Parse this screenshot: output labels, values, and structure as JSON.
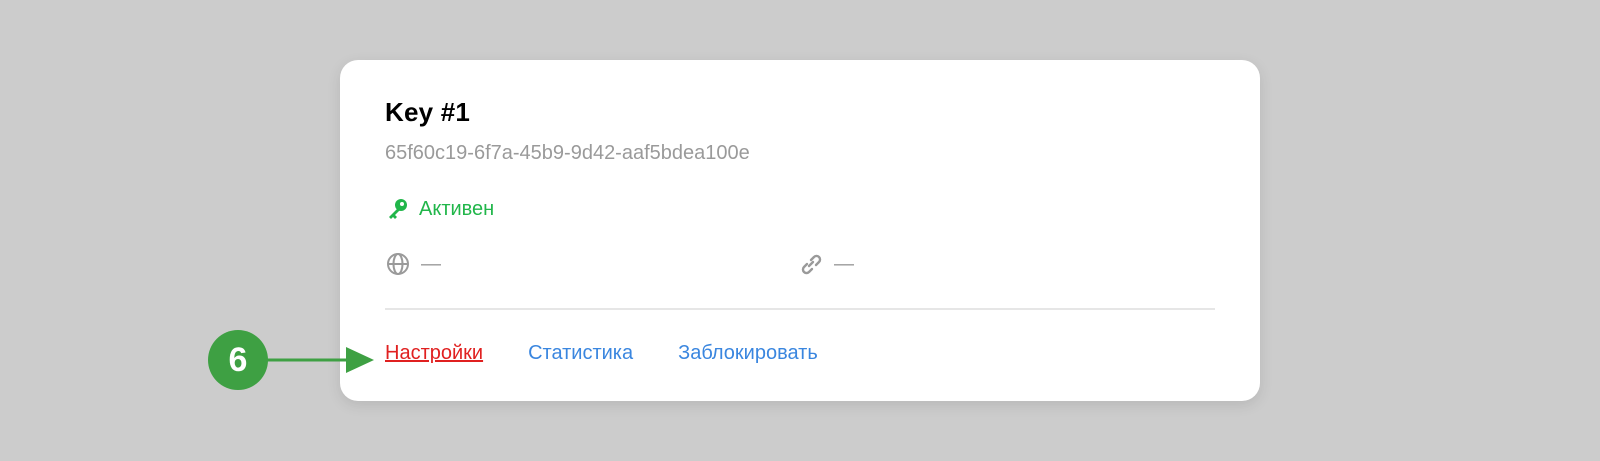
{
  "card": {
    "title": "Key #1",
    "key_id": "65f60c19-6f7a-45b9-9d42-aaf5bdea100e",
    "status": {
      "label": "Активен",
      "icon": "key-icon",
      "color": "#21b64a"
    },
    "meta": {
      "domain": {
        "icon": "globe-icon",
        "value": "—"
      },
      "link": {
        "icon": "link-icon",
        "value": "—"
      }
    },
    "actions": [
      {
        "label": "Настройки",
        "color": "#e02020",
        "active": true
      },
      {
        "label": "Статистика",
        "color": "#3a86df"
      },
      {
        "label": "Заблокировать",
        "color": "#3a86df"
      }
    ]
  },
  "annotation": {
    "number": "6",
    "color": "#3ea043"
  }
}
